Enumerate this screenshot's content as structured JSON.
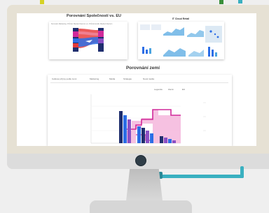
{
  "sections": {
    "top_left_title": "Porovnání Společností vs. EU",
    "top_right_title": "IT Cloud Retail",
    "main_title": "Porovnání zemí"
  },
  "top_left_card": {
    "subtitle": "Srovnání Marketing: Průměr Média Kriterium vs. Průměrná EU Média Kriterium"
  },
  "main_card": {
    "tabs": [
      "Celkové příjmy podle zemí",
      "Marketing",
      "Média",
      "Strategie",
      "Nová média"
    ],
    "legend": [
      "Legenda",
      "Země",
      "EU"
    ]
  },
  "colors": {
    "accent_teal": "#3ab0c0",
    "accent_yellow": "#d6d226",
    "accent_green": "#3a8f3a",
    "bar_navy": "#1f2e6e",
    "bar_blue": "#2c6ee6",
    "bar_purple": "#8a4fc4",
    "area_pink": "#f4b6dc",
    "line_magenta": "#d02a9a",
    "map_blue": "#4aa3e0"
  },
  "icons": [
    "monitor-camera-icon"
  ]
}
